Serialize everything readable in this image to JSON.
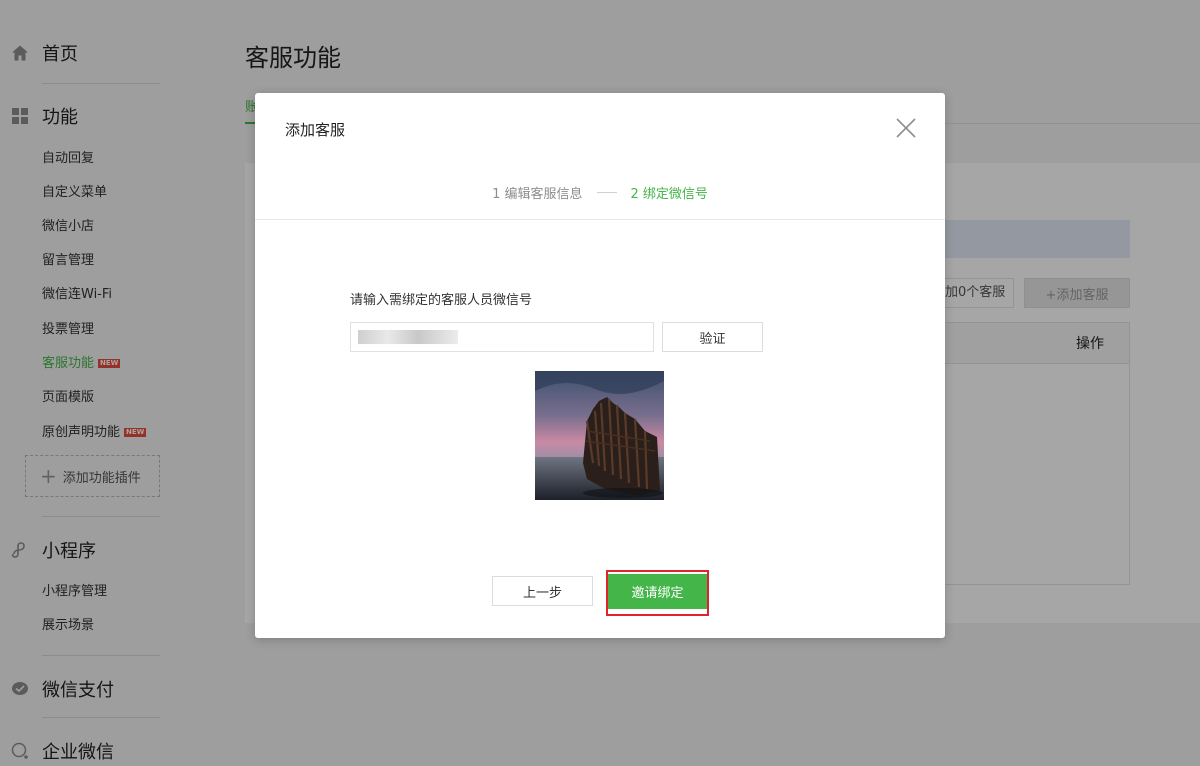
{
  "sidebar": {
    "home": {
      "label": "首页",
      "icon": "home-icon"
    },
    "features": {
      "label": "功能",
      "icon": "grid-icon",
      "items": [
        {
          "label": "自动回复"
        },
        {
          "label": "自定义菜单"
        },
        {
          "label": "微信小店"
        },
        {
          "label": "留言管理"
        },
        {
          "label": "微信连Wi-Fi"
        },
        {
          "label": "投票管理"
        },
        {
          "label": "客服功能",
          "badge": "NEW",
          "active": true
        },
        {
          "label": "页面模版"
        },
        {
          "label": "原创声明功能",
          "badge": "NEW"
        }
      ],
      "add_plugin": "添加功能插件"
    },
    "miniprogram": {
      "label": "小程序",
      "icon": "miniprogram-icon",
      "items": [
        {
          "label": "小程序管理"
        },
        {
          "label": "展示场景"
        }
      ]
    },
    "wechat_pay": {
      "label": "微信支付",
      "icon": "wechat-pay-icon"
    },
    "work_wechat": {
      "label": "企业微信",
      "icon": "work-wechat-icon"
    }
  },
  "main": {
    "title": "客服功能",
    "tab_partial": "账",
    "count_text": "加0个客服",
    "add_button": "+添加客服",
    "table_header_action": "操作"
  },
  "dialog": {
    "title": "添加客服",
    "steps": [
      {
        "label": "1 编辑客服信息",
        "active": false
      },
      {
        "label": "2 绑定微信号",
        "active": true
      }
    ],
    "field_label": "请输入需绑定的客服人员微信号",
    "input_value": "",
    "verify_button": "验证",
    "prev_button": "上一步",
    "invite_button": "邀请绑定"
  },
  "colors": {
    "accent_green": "#44b549",
    "highlight_red": "#e0242c",
    "badge_red": "#e84c3d"
  }
}
